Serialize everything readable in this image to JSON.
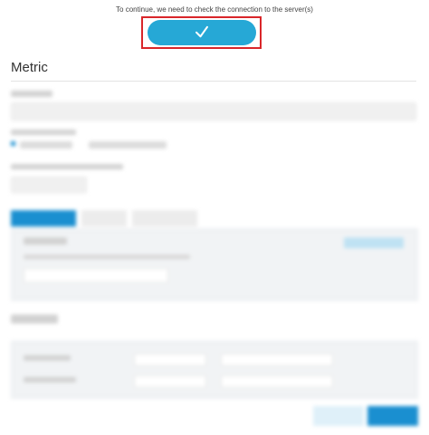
{
  "header": {
    "notice": "To continue, we need to check the connection to the server(s)",
    "check_icon": "checkmark-icon"
  },
  "section": {
    "title": "Metric"
  },
  "colors": {
    "accent": "#26a8d6",
    "highlight_frame": "#d9262a"
  }
}
